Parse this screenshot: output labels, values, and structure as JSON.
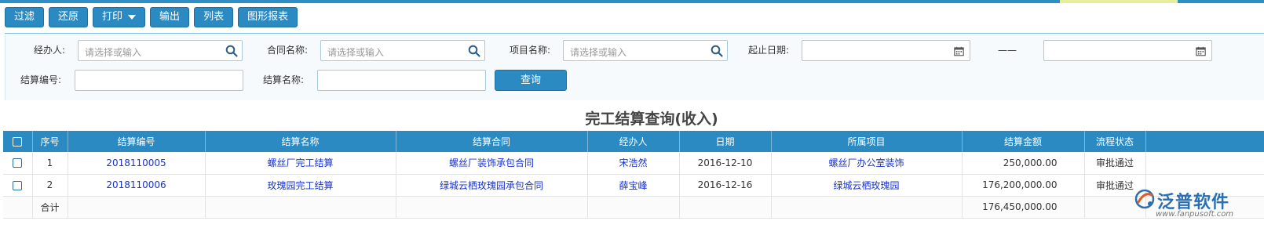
{
  "toolbar": {
    "filter": "过滤",
    "restore": "还原",
    "print": "打印",
    "export": "输出",
    "list": "列表",
    "chart_report": "图形报表"
  },
  "filters": {
    "handler_label": "经办人:",
    "handler_placeholder": "请选择或输入",
    "contract_label": "合同名称:",
    "contract_placeholder": "请选择或输入",
    "project_label": "项目名称:",
    "project_placeholder": "请选择或输入",
    "date_label": "起止日期:",
    "date_separator": "——",
    "settle_no_label": "结算编号:",
    "settle_name_label": "结算名称:",
    "query_button": "查询"
  },
  "report": {
    "title": "完工结算查询(收入)"
  },
  "table": {
    "headers": [
      "序号",
      "结算编号",
      "结算名称",
      "结算合同",
      "经办人",
      "日期",
      "所属项目",
      "结算金额",
      "流程状态"
    ],
    "rows": [
      {
        "seq": "1",
        "code": "2018110005",
        "name": "螺丝厂完工结算",
        "contract": "螺丝厂装饰承包合同",
        "handler": "宋浩然",
        "date": "2016-12-10",
        "project": "螺丝厂办公室装饰",
        "amount": "250,000.00",
        "status": "审批通过"
      },
      {
        "seq": "2",
        "code": "2018110006",
        "name": "玫瑰园完工结算",
        "contract": "绿城云栖玫瑰园承包合同",
        "handler": "薛宝峰",
        "date": "2016-12-16",
        "project": "绿城云栖玫瑰园",
        "amount": "176,200,000.00",
        "status": "审批通过"
      }
    ],
    "total": {
      "label": "合计",
      "amount": "176,450,000.00"
    }
  },
  "logo": {
    "name": "泛普软件",
    "url": "www.fanpusoft.com"
  },
  "colors": {
    "accent": "#2b8ac1",
    "link": "#1a33cc"
  }
}
